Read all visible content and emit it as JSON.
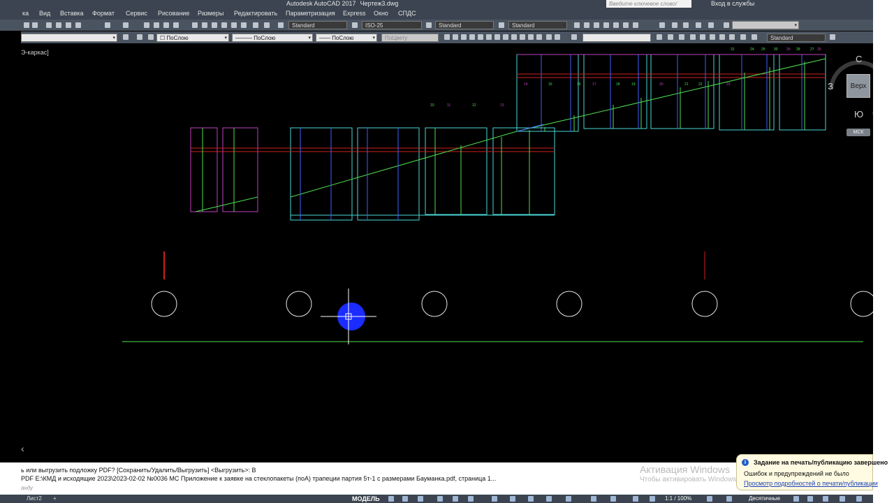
{
  "window": {
    "title": "Autodesk AutoCAD 2017",
    "file": "Чертеж3.dwg",
    "search_placeholder": "Введите ключевое слово/фразу",
    "login": "Вход в службы"
  },
  "menu": [
    "ка",
    "Вид",
    "Вставка",
    "Формат",
    "Сервис",
    "Рисование",
    "Размеры",
    "Редактировать",
    "Параметризация",
    "Express",
    "Окно",
    "СПДС"
  ],
  "toolbar1": {
    "text_style": "Standard",
    "dim_style": "ISO-25",
    "table_style": "Standard",
    "mleader_style": "Standard"
  },
  "toolbar2": {
    "layer_color": "ПоСлою",
    "linetype": "ПоСлою",
    "lineweight": "ПоСлою",
    "plotstyle": "ПоЦвету",
    "style_right": "Standard"
  },
  "viewport": {
    "label": "Э-каркас]",
    "viewcube": {
      "north": "С",
      "west": "З",
      "south": "Ю",
      "top": "Верх",
      "wcs": "МСК"
    }
  },
  "drawing_labels": {
    "upper_tags": [
      "14",
      "15",
      "16",
      "17",
      "18",
      "19",
      "20",
      "21",
      "22",
      "23",
      "24",
      "25",
      "26",
      "27",
      "28",
      "29",
      "30",
      "31"
    ],
    "mid_tags": [
      "10",
      "11",
      "12",
      "13"
    ]
  },
  "command": {
    "line1": "ь или выгрузить подложку PDF? [Сохранить/Удалить/Выгрузить] <Выгрузить>: В",
    "line2": "PDF E:\\КМД и исходящие 2023\\2023-02-02 №0036 МС Приложение к заявке  на стеклопакеты (поА)  трапеции  партия 5т-1 с размерами  Бауманка.pdf, страница 1...",
    "input_placeholder": "анду"
  },
  "activation": {
    "title": "Активация Windows",
    "subtitle": "Чтобы активировать Windows"
  },
  "notification": {
    "title": "Задание на печать/публикацию завершено",
    "text": "Ошибок и предупреждений не было",
    "link": "Просмотр подробностей о печати/публикации"
  },
  "statusbar": {
    "tab": "Лист2",
    "add_tab": "+",
    "model": "МОДЕЛЬ",
    "scale": "1:1 / 100%",
    "units": "Десятичные"
  },
  "colors": {
    "green_lines": "#4ee04e",
    "cyan_lines": "#4ad9d9",
    "magenta_lines": "#c040c0",
    "red_lines": "#d02020",
    "blue_lines": "#4060ff",
    "selection_dot": "#1a2cff"
  }
}
